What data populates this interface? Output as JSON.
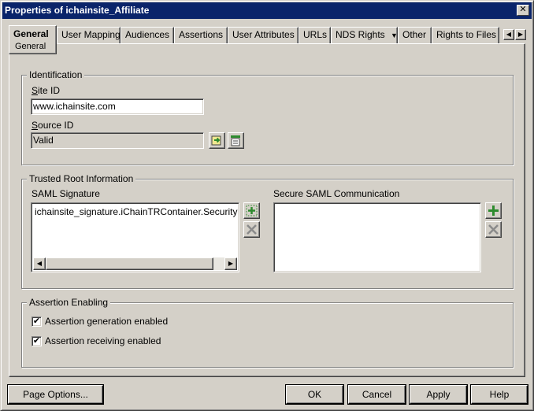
{
  "window": {
    "title": "Properties of ichainsite_Affiliate",
    "close_glyph": "✕"
  },
  "tabs": {
    "items": [
      {
        "label": "General",
        "active": true
      },
      {
        "label": "User Mapping"
      },
      {
        "label": "Audiences"
      },
      {
        "label": "Assertions"
      },
      {
        "label": "User Attributes"
      },
      {
        "label": "URLs"
      },
      {
        "label": "NDS Rights",
        "has_dropdown": true
      },
      {
        "label": "Other"
      },
      {
        "label": "Rights to Files a"
      }
    ],
    "subtab": "General",
    "dropdown_glyph": "▼",
    "scroll_left_glyph": "◀",
    "scroll_right_glyph": "▶"
  },
  "identification": {
    "group_label": "Identification",
    "site_id_label": "Site ID",
    "site_id_value": "www.ichainsite.com",
    "source_id_label": "Source ID",
    "source_id_value": "Valid",
    "icons": [
      "browse-icon",
      "edit-icon"
    ]
  },
  "trusted_root": {
    "group_label": "Trusted Root Information",
    "saml_signature_label": "SAML Signature",
    "saml_signature_items": [
      "ichainsite_signature.iChainTRContainer.Security"
    ],
    "secure_saml_label": "Secure SAML Communication",
    "secure_saml_items": [],
    "icons": [
      "add-icon",
      "delete-icon"
    ]
  },
  "assertion_enabling": {
    "group_label": "Assertion Enabling",
    "generation_label": "Assertion generation enabled",
    "generation_checked": true,
    "receiving_label": "Assertion receiving enabled",
    "receiving_checked": true,
    "check_glyph": "✔"
  },
  "footer": {
    "page_options": "Page Options...",
    "ok": "OK",
    "cancel": "Cancel",
    "apply": "Apply",
    "help": "Help"
  },
  "colors": {
    "title_bar": "#0a246a",
    "face": "#d4d0c8",
    "icon_green": "#2e8b2e"
  }
}
